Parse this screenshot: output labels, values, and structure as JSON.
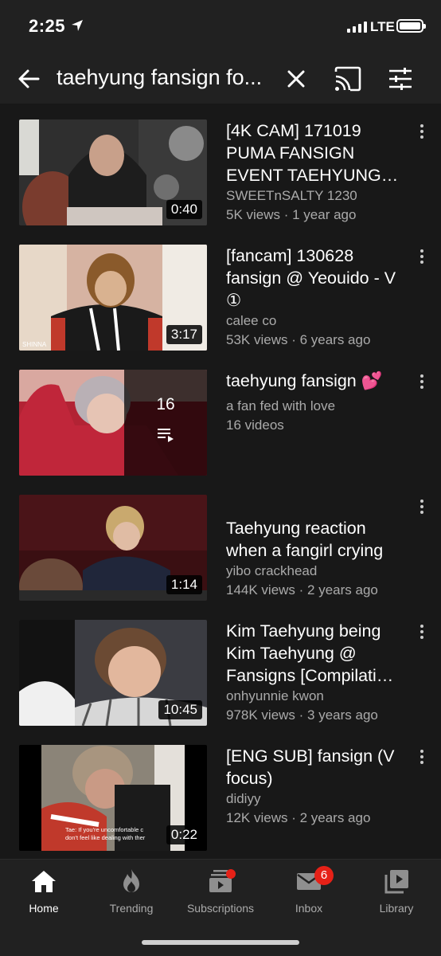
{
  "status_bar": {
    "time": "2:25",
    "network": "LTE"
  },
  "search": {
    "query": "taehyung fansign fo..."
  },
  "results": [
    {
      "type": "video",
      "title": "[4K CAM] 171019 PUMA FANSIGN EVENT TAEHYUNG…",
      "channel": "SWEETnSALTY 1230",
      "views_age": "5K views · 1 year ago",
      "duration": "0:40"
    },
    {
      "type": "video",
      "title": "[fancam] 130628 fansign @ Yeouido - V ①",
      "channel": "calee co",
      "views_age": "53K views · 6 years ago",
      "duration": "3:17",
      "thumb_watermark": "SHINNA"
    },
    {
      "type": "playlist",
      "title": "taehyung fansign 💕",
      "channel": "a fan fed with love",
      "video_count_text": "16 videos",
      "count": "16"
    },
    {
      "type": "video",
      "title": "Taehyung reaction when a fangirl crying",
      "channel": "yibo crackhead",
      "views_age": "144K views · 2 years ago",
      "duration": "1:14"
    },
    {
      "type": "video",
      "title": "Kim Taehyung being Kim Taehyung @ Fansigns [Compilati…",
      "channel": "onhyunnie kwon",
      "views_age": "978K views · 3 years ago",
      "duration": "10:45"
    },
    {
      "type": "video",
      "title": "[ENG SUB] fansign (V focus)",
      "channel": "didiyy",
      "views_age": "12K views · 2 years ago",
      "duration": "0:22",
      "thumb_caption_1": "Tae: If you're uncomfortable c",
      "thumb_caption_2": "don't feel like dealing with ther"
    }
  ],
  "nav": [
    {
      "label": "Home",
      "active": true
    },
    {
      "label": "Trending"
    },
    {
      "label": "Subscriptions"
    },
    {
      "label": "Inbox",
      "badge": "6"
    },
    {
      "label": "Library"
    }
  ],
  "colors": {
    "background": "#181818",
    "header": "#212121",
    "badge": "#e62117",
    "meta_text": "#aaaaaa"
  }
}
